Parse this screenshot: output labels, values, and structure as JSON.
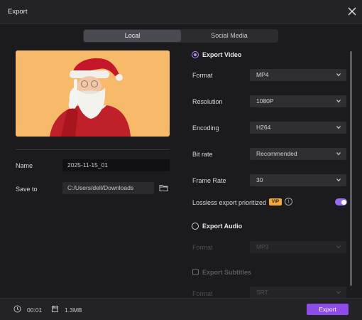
{
  "window": {
    "title": "Export"
  },
  "tabs": [
    {
      "label": "Local"
    },
    {
      "label": "Social Media"
    }
  ],
  "left": {
    "name_label": "Name",
    "name_value": "2025-11-15_01",
    "save_label": "Save to",
    "save_value": "C:/Users/dell/Downloads"
  },
  "video": {
    "heading": "Export Video",
    "rows": [
      {
        "label": "Format",
        "value": "MP4"
      },
      {
        "label": "Resolution",
        "value": "1080P"
      },
      {
        "label": "Encoding",
        "value": "H264"
      },
      {
        "label": "Bit rate",
        "value": "Recommended"
      },
      {
        "label": "Frame Rate",
        "value": "30"
      }
    ],
    "lossless_label": "Lossless export prioritized",
    "vip_badge": "VIP",
    "info_glyph": "i"
  },
  "audio": {
    "heading": "Export Audio",
    "format_label": "Format",
    "format_value": "MP3"
  },
  "subtitles": {
    "heading": "Export Subtitles",
    "format_label": "Format",
    "format_value": "SRT"
  },
  "footer": {
    "duration": "00:01",
    "size": "1.3MB",
    "export_label": "Export"
  },
  "colors": {
    "accent": "#8d4bea",
    "vip": "#f2a93b",
    "thumbnail_bg": "#f7b96a",
    "panel": "#1b1b1d"
  },
  "icons": [
    "close-icon",
    "folder-icon",
    "chevron-down-icon",
    "info-icon",
    "clock-icon",
    "file-size-icon",
    "santa-thumbnail"
  ]
}
